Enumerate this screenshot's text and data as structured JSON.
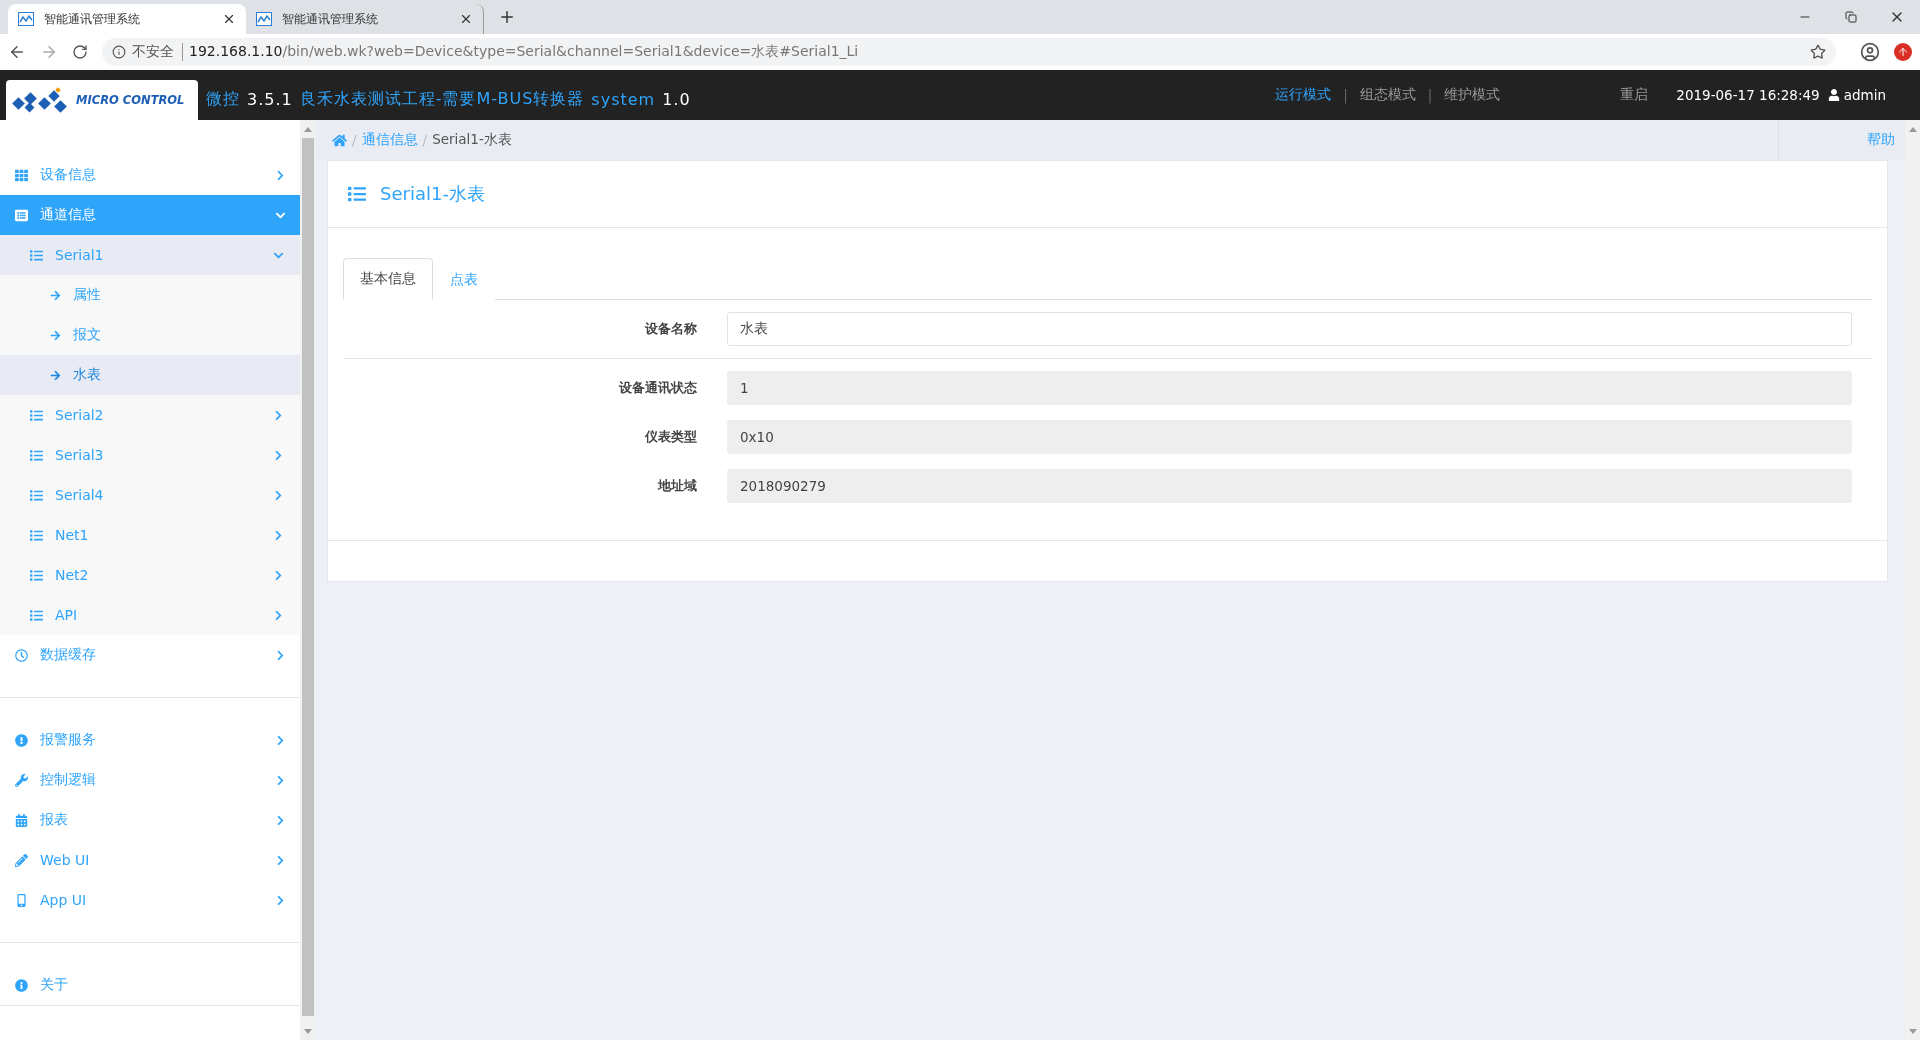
{
  "browser": {
    "tabs": [
      {
        "title": "智能通讯管理系统",
        "selected": true
      },
      {
        "title": "智能通讯管理系统",
        "selected": false
      }
    ],
    "address": {
      "security": "不安全",
      "host": "192.168.1.10",
      "path": "/bin/web.wk?web=Device&type=Serial&channel=Serial1&device=水表#Serial1_Li"
    }
  },
  "header": {
    "logo": "MICRO CONTROL",
    "brand": "微控",
    "version": "3.5.1",
    "project": "良禾水表测试工程-需要M-BUS转换器",
    "system": "system",
    "system_version": "1.0",
    "mode_separator": "|",
    "modes": [
      {
        "label": "运行模式",
        "selected": true
      },
      {
        "label": "组态模式",
        "selected": false
      },
      {
        "label": "维护模式",
        "selected": false
      }
    ],
    "restart": "重启",
    "datetime": "2019-06-17 16:28:49",
    "user": "admin"
  },
  "sidebar": {
    "sections": [
      {
        "items": [
          {
            "label": "设备信息",
            "selected": false,
            "expanded": false
          },
          {
            "label": "通道信息",
            "selected": true,
            "expanded": true,
            "children": [
              {
                "label": "Serial1",
                "selected": false,
                "expanded": true,
                "children": [
                  {
                    "label": "属性",
                    "selected": false
                  },
                  {
                    "label": "报文",
                    "selected": false
                  },
                  {
                    "label": "水表",
                    "selected": true
                  }
                ]
              },
              {
                "label": "Serial2",
                "selected": false,
                "expanded": false
              },
              {
                "label": "Serial3",
                "selected": false,
                "expanded": false
              },
              {
                "label": "Serial4",
                "selected": false,
                "expanded": false
              },
              {
                "label": "Net1",
                "selected": false,
                "expanded": false
              },
              {
                "label": "Net2",
                "selected": false,
                "expanded": false
              },
              {
                "label": "API",
                "selected": false,
                "expanded": false
              }
            ]
          },
          {
            "label": "数据缓存",
            "selected": false,
            "expanded": false
          }
        ]
      },
      {
        "items": [
          {
            "label": "报警服务",
            "selected": false,
            "expanded": false
          },
          {
            "label": "控制逻辑",
            "selected": false,
            "expanded": false
          },
          {
            "label": "报表",
            "selected": false,
            "expanded": false
          },
          {
            "label": "Web UI",
            "selected": false,
            "expanded": false
          },
          {
            "label": "App UI",
            "selected": false,
            "expanded": false
          }
        ]
      },
      {
        "items": [
          {
            "label": "关于",
            "selected": false
          }
        ]
      }
    ]
  },
  "breadcrumb": {
    "separator": "/",
    "items": [
      "通信信息",
      "Serial1-水表"
    ],
    "help": "帮助"
  },
  "panel": {
    "title": "Serial1-水表",
    "tabs": [
      {
        "label": "基本信息",
        "selected": true
      },
      {
        "label": "点表",
        "selected": false
      }
    ],
    "sections": [
      {
        "fields": [
          {
            "label": "设备名称",
            "value": "水表",
            "readonly": false
          }
        ]
      },
      {
        "fields": [
          {
            "label": "设备通讯状态",
            "value": "1",
            "readonly": true
          },
          {
            "label": "仪表类型",
            "value": "0x10",
            "readonly": true
          },
          {
            "label": "地址域",
            "value": "2018090279",
            "readonly": true
          }
        ]
      }
    ]
  }
}
